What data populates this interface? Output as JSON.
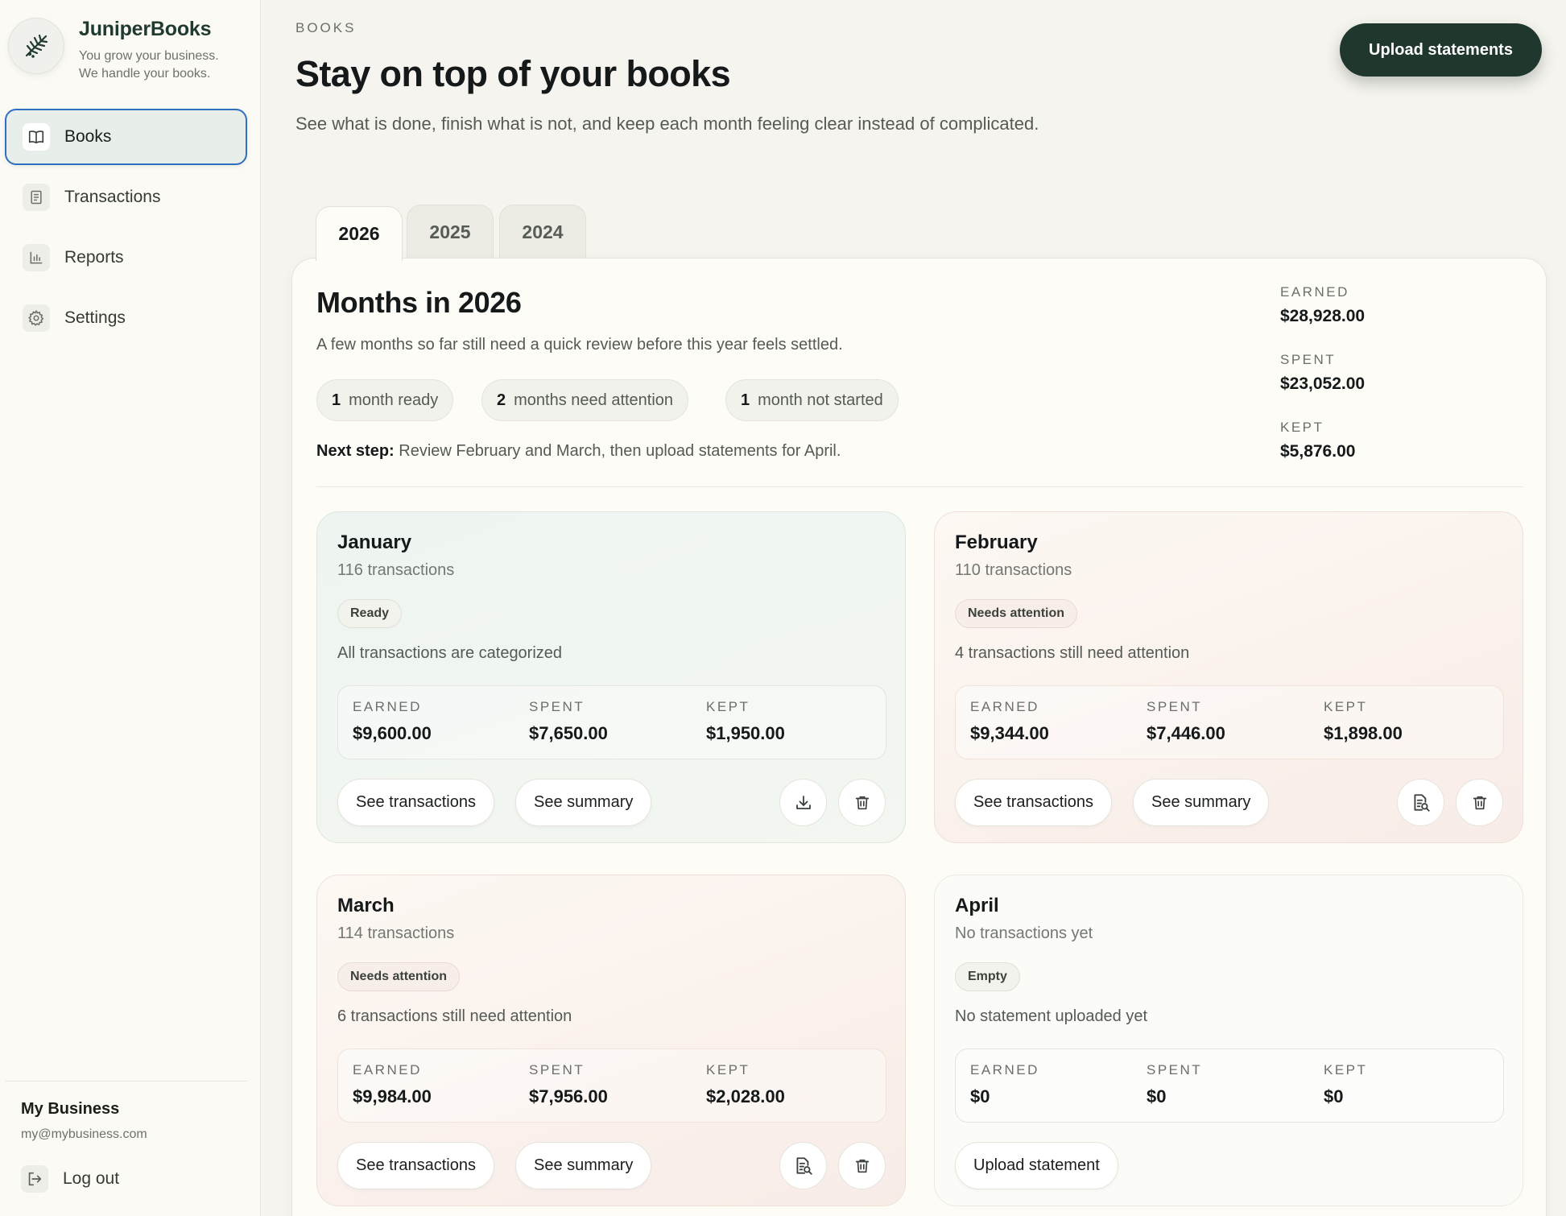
{
  "brand": {
    "name": "JuniperBooks",
    "tagline_1": "You grow your business.",
    "tagline_2": "We handle your books."
  },
  "sidebar": {
    "items": [
      {
        "label": "Books",
        "icon": "book-icon",
        "active": true
      },
      {
        "label": "Transactions",
        "icon": "receipt-icon"
      },
      {
        "label": "Reports",
        "icon": "bar-chart-icon"
      },
      {
        "label": "Settings",
        "icon": "gear-icon"
      }
    ],
    "business_name": "My Business",
    "business_email": "my@mybusiness.com",
    "logout_label": "Log out"
  },
  "header": {
    "eyebrow": "BOOKS",
    "title": "Stay on top of your books",
    "subtitle": "See what is done, finish what is not, and keep each month feeling clear instead of complicated.",
    "upload_label": "Upload statements"
  },
  "tabs": [
    {
      "label": "2026",
      "active": true
    },
    {
      "label": "2025"
    },
    {
      "label": "2024"
    }
  ],
  "year_panel": {
    "title": "Months in 2026",
    "subtitle": "A few months so far still need a quick review before this year feels settled.",
    "pills": [
      {
        "count": "1",
        "label": "month ready"
      },
      {
        "count": "2",
        "label": "months need attention"
      },
      {
        "count": "1",
        "label": "month not started"
      }
    ],
    "next_step_label": "Next step:",
    "next_step_text": "Review February and March, then upload statements for April.",
    "totals": {
      "earned_label": "EARNED",
      "earned": "$28,928.00",
      "spent_label": "SPENT",
      "spent": "$23,052.00",
      "kept_label": "KEPT",
      "kept": "$5,876.00"
    }
  },
  "stat_labels": {
    "earned": "EARNED",
    "spent": "SPENT",
    "kept": "KEPT"
  },
  "months": [
    {
      "name": "January",
      "count": "116 transactions",
      "badge": "Ready",
      "status": "All transactions are categorized",
      "earned": "$9,600.00",
      "spent": "$7,650.00",
      "kept": "$1,950.00",
      "btn_transactions": "See transactions",
      "btn_summary": "See summary",
      "action_icon": "download-icon"
    },
    {
      "name": "February",
      "count": "110 transactions",
      "badge": "Needs attention",
      "status": "4 transactions still need attention",
      "earned": "$9,344.00",
      "spent": "$7,446.00",
      "kept": "$1,898.00",
      "btn_transactions": "See transactions",
      "btn_summary": "See summary",
      "action_icon": "document-search-icon"
    },
    {
      "name": "March",
      "count": "114 transactions",
      "badge": "Needs attention",
      "status": "6 transactions still need attention",
      "earned": "$9,984.00",
      "spent": "$7,956.00",
      "kept": "$2,028.00",
      "btn_transactions": "See transactions",
      "btn_summary": "See summary",
      "action_icon": "document-search-icon"
    },
    {
      "name": "April",
      "count": "No transactions yet",
      "badge": "Empty",
      "status": "No statement uploaded yet",
      "earned": "$0",
      "spent": "$0",
      "kept": "$0",
      "btn_upload": "Upload statement"
    }
  ],
  "colors": {
    "accent_dark": "#20372d",
    "active_outline": "#2f6fc2",
    "ready_card": "#eef5f1",
    "attention_card": "#f8ece7"
  }
}
